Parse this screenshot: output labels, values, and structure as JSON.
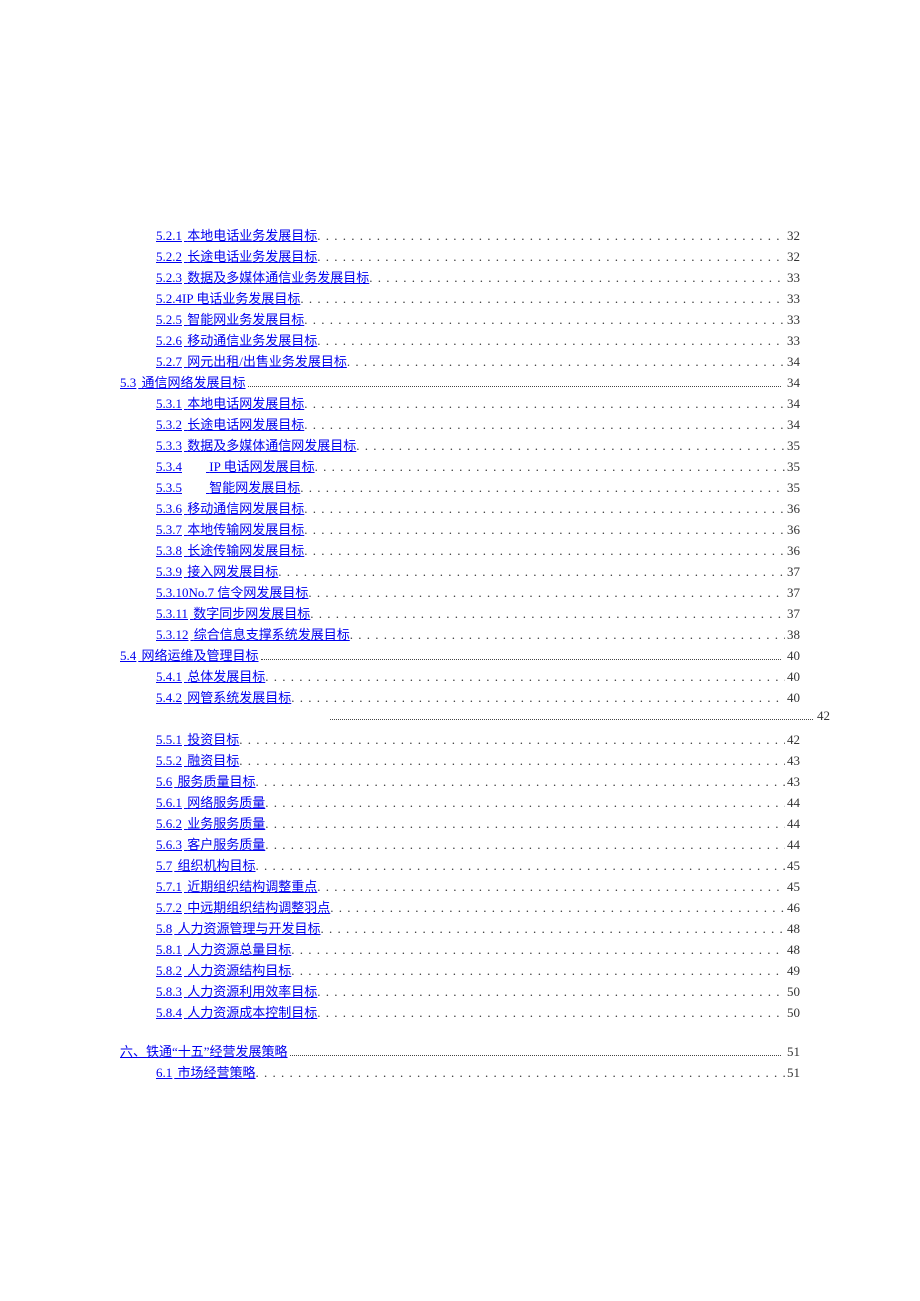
{
  "toc": [
    {
      "level": 2,
      "num": "5.2.1",
      "label": "本地电话业务发展目标",
      "page": "32"
    },
    {
      "level": 2,
      "num": "5.2.2",
      "label": "长途电话业务发展目标",
      "page": "32"
    },
    {
      "level": 2,
      "num": "5.2.3",
      "label": "数据及多媒体通信业务发展目标",
      "page": "33"
    },
    {
      "level": 2,
      "num": "5.2.4",
      "label": "IP 电话业务发展目标",
      "page": "33",
      "tight": true
    },
    {
      "level": 2,
      "num": "5.2.5",
      "label": "智能网业务发展目标",
      "page": "33"
    },
    {
      "level": 2,
      "num": "5.2.6",
      "label": "移动通信业务发展目标",
      "page": "33"
    },
    {
      "level": 2,
      "num": "5.2.7",
      "label": "网元出租/出售业务发展目标",
      "page": "34"
    },
    {
      "level": 1,
      "num": "5.3",
      "label": "通信网络发展目标",
      "page": "34"
    },
    {
      "level": 2,
      "num": "5.3.1",
      "label": "本地电话网发展目标",
      "page": "34"
    },
    {
      "level": 2,
      "num": "5.3.2",
      "label": "长途电话网发展目标",
      "page": "34"
    },
    {
      "level": 2,
      "num": "5.3.3",
      "label": "数据及多媒体通信网发展目标",
      "page": "35"
    },
    {
      "level": 2,
      "num": "5.3.4",
      "label": "IP 电话网发展目标",
      "page": "35",
      "gap": true
    },
    {
      "level": 2,
      "num": "5.3.5",
      "label": "智能网发展目标",
      "page": "35",
      "gap": true
    },
    {
      "level": 2,
      "num": "5.3.6",
      "label": "移动通信网发展目标",
      "page": "36"
    },
    {
      "level": 2,
      "num": "5.3.7",
      "label": "本地传输网发展目标",
      "page": "36"
    },
    {
      "level": 2,
      "num": "5.3.8",
      "label": "长途传输网发展目标",
      "page": "36"
    },
    {
      "level": 2,
      "num": "5.3.9",
      "label": "接入网发展目标",
      "page": "37"
    },
    {
      "level": 2,
      "num": "5.3.10",
      "label": "No.7 信令网发展目标",
      "page": "37",
      "tight": true
    },
    {
      "level": 2,
      "num": "5.3.11",
      "label": "数字同步网发展目标",
      "page": "37"
    },
    {
      "level": 2,
      "num": "5.3.12",
      "label": "综合信息支撑系统发展目标",
      "page": "38"
    },
    {
      "level": 1,
      "num": "5.4",
      "label": "网络运维及管理目标",
      "page": "40"
    },
    {
      "level": 2,
      "num": "5.4.1",
      "label": "总体发展目标",
      "page": "40"
    },
    {
      "level": 2,
      "num": "5.4.2",
      "label": "网管系统发展目标",
      "page": "40"
    },
    {
      "level": "extra",
      "page": "42"
    },
    {
      "level": 2,
      "num": "5.5.1",
      "label": "投资目标",
      "page": "42"
    },
    {
      "level": 2,
      "num": "5.5.2",
      "label": "融资目标",
      "page": "43"
    },
    {
      "level": 2,
      "num": "5.6",
      "label": "服务质量目标",
      "page": "43"
    },
    {
      "level": 2,
      "num": "5.6.1",
      "label": "网络服务质量",
      "page": "44"
    },
    {
      "level": 2,
      "num": "5.6.2",
      "label": "业务服务质量",
      "page": "44"
    },
    {
      "level": 2,
      "num": "5.6.3",
      "label": "客户服务质量",
      "page": "44"
    },
    {
      "level": 2,
      "num": "5.7",
      "label": "组织机构目标",
      "page": "45"
    },
    {
      "level": 2,
      "num": "5.7.1",
      "label": "近期组织结构调整重点",
      "page": "45"
    },
    {
      "level": 2,
      "num": "5.7.2",
      "label": "中远期组织结构调整羽点",
      "page": "46"
    },
    {
      "level": 2,
      "num": "5.8",
      "label": "人力资源管理与开发目标",
      "page": "48"
    },
    {
      "level": 2,
      "num": "5.8.1",
      "label": "人力资源总量目标",
      "page": "48"
    },
    {
      "level": 2,
      "num": "5.8.2",
      "label": "人力资源结构目标",
      "page": "49"
    },
    {
      "level": 2,
      "num": "5.8.3",
      "label": "人力资源利用效率目标",
      "page": "50"
    },
    {
      "level": 2,
      "num": "5.8.4",
      "label": "人力资源成本控制目标",
      "page": "50"
    },
    {
      "level": "spacer"
    },
    {
      "level": 1,
      "num": "六、",
      "label": "铁通“十五”经营发展策略",
      "page": "51",
      "tight": true
    },
    {
      "level": 2,
      "num": "6.1",
      "label": "市场经营策略",
      "page": "51"
    }
  ],
  "leader_char": ". . . . . . . . . . . . . . . . . . . . . . . . . . . . . . . . . . . . . . . . . . . . . . . . . . . . . . . . . . . . . . . . . . . . . . . . . . . . . . . . . . . . . . . . . . . . . . . . . . . . . . . . . . . . . ."
}
